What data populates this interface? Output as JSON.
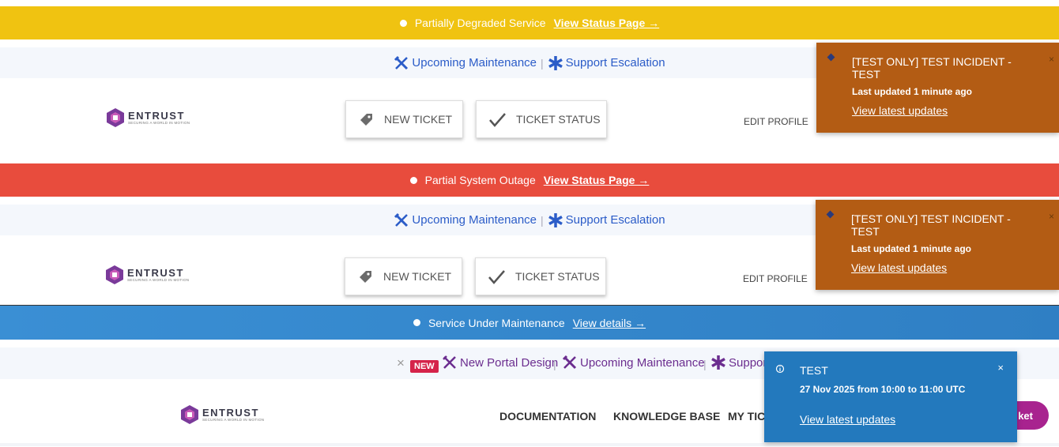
{
  "rows": [
    {
      "banner": {
        "text": "Partially Degraded Service",
        "link": "View Status Page →",
        "color": "#f0c311"
      },
      "subnav": {
        "maintenance": "Upcoming Maintenance",
        "escalation": "Support Escalation"
      },
      "header": {
        "logo_word": "ENTRUST",
        "logo_tag": "SECURING A WORLD IN MOTION",
        "new_ticket": "NEW TICKET",
        "ticket_status": "TICKET STATUS",
        "edit_profile": "EDIT PROFILE"
      },
      "toast": {
        "title": "[TEST ONLY] TEST INCIDENT - TEST",
        "updated": "Last updated 1 minute ago",
        "link": "View latest updates",
        "close": "×"
      }
    },
    {
      "banner": {
        "text": "Partial System Outage",
        "link": "View Status Page →",
        "color": "#e84c3d"
      },
      "subnav": {
        "maintenance": "Upcoming Maintenance",
        "escalation": "Support Escalation"
      },
      "header": {
        "logo_word": "ENTRUST",
        "logo_tag": "SECURING A WORLD IN MOTION",
        "new_ticket": "NEW TICKET",
        "ticket_status": "TICKET STATUS",
        "edit_profile": "EDIT PROFILE"
      },
      "toast": {
        "title": "[TEST ONLY] TEST INCIDENT - TEST",
        "updated": "Last updated 1 minute ago",
        "link": "View latest updates",
        "close": "×"
      }
    },
    {
      "banner": {
        "text": "Service Under Maintenance",
        "link": "View details →",
        "color": "#3a8fd4"
      },
      "subnav": {
        "dismiss": "×",
        "new_badge": "NEW",
        "portal": "New Portal Design",
        "maintenance": "Upcoming Maintenance",
        "escalation": "Suppor"
      },
      "header": {
        "logo_word": "ENTRUST",
        "logo_tag": "SECURING A WORLD IN MOTION",
        "nav": [
          "DOCUMENTATION",
          "KNOWLEDGE BASE",
          "MY TIC"
        ],
        "cta": "ket"
      },
      "toast": {
        "title": "TEST",
        "schedule": "27 Nov 2025 from 10:00 to 11:00 UTC",
        "link": "View latest updates",
        "close": "×"
      }
    }
  ],
  "colors": {
    "link_blue": "#2b5cc8",
    "purple": "#6b2d8f",
    "toast_orange": "#b35c14",
    "toast_blue": "#2379bd",
    "cta": "#a8238f",
    "badge_red": "#d5234a"
  }
}
